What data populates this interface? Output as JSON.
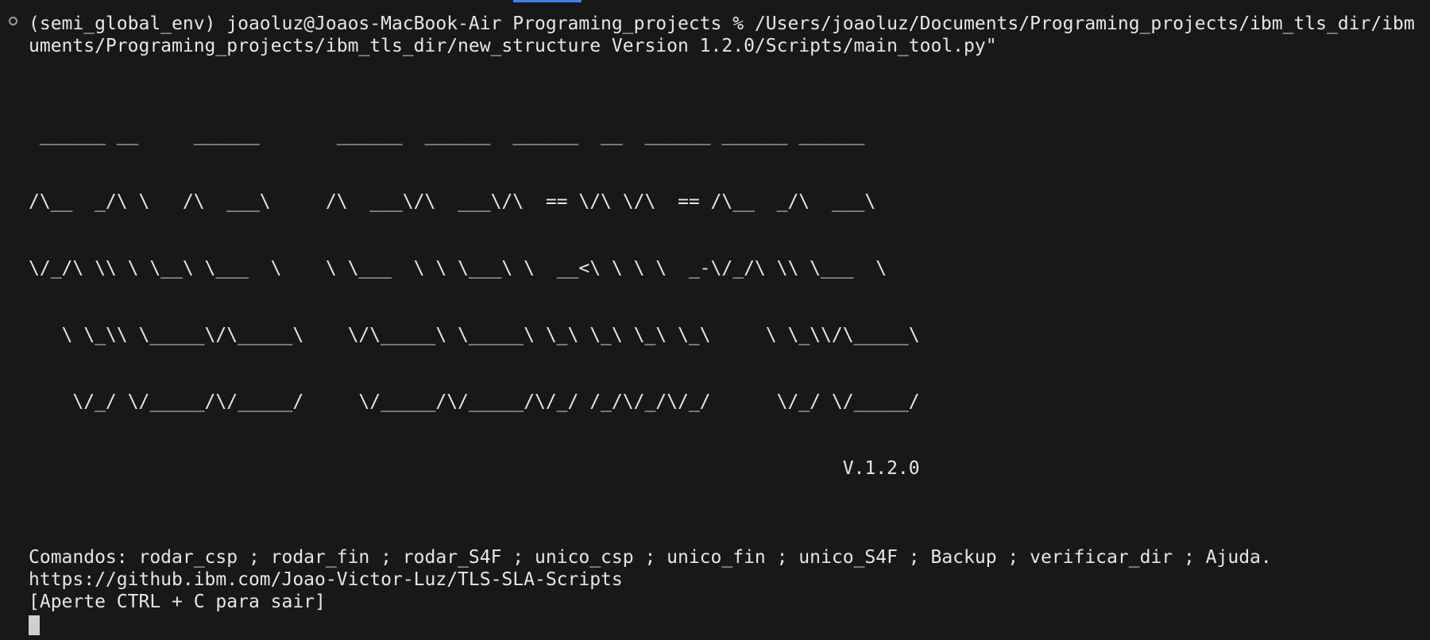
{
  "terminal": {
    "prompt_line": "(semi_global_env) joaoluz@Joaos-MacBook-Air Programing_projects % /Users/joaoluz/Documents/Programing_projects/ibm_tls_dir/ibm",
    "prompt_line_wrap": "uments/Programing_projects/ibm_tls_dir/new_structure Version 1.2.0/Scripts/main_tool.py\"",
    "ascii_banner": [
      " ______ __     ______       ______  ______  ______  __  ______ ______ ______",
      "/\\__  _/\\ \\   /\\  ___\\     /\\  ___\\/\\  ___\\/\\  == \\/\\ \\/\\  == /\\__  _/\\  ___\\",
      "\\/_/\\ \\\\ \\ \\__\\ \\___  \\    \\ \\___  \\ \\ \\___\\ \\  __<\\ \\ \\ \\  _-\\/_/\\ \\\\ \\___  \\",
      "   \\ \\_\\\\ \\_____\\/\\_____\\    \\/\\_____\\ \\_____\\ \\_\\ \\_\\ \\_\\ \\_\\     \\ \\_\\\\/\\_____\\",
      "    \\/_/ \\/_____/\\/_____/     \\/_____/\\/_____/\\/_/ /_/\\/_/\\/_/      \\/_/ \\/_____/",
      "                                                                          V.1.2.0"
    ],
    "commands_line": "Comandos: rodar_csp ; rodar_fin ; rodar_S4F ; unico_csp ; unico_fin ; unico_S4F ; Backup ; verificar_dir ; Ajuda.",
    "repo_url": "https://github.ibm.com/Joao-Victor-Luz/TLS-SLA-Scripts",
    "exit_hint": "[Aperte CTRL + C para sair]"
  },
  "colors": {
    "background": "#181818",
    "text": "#e6e6e6",
    "tab_indicator": "#3b82f6"
  }
}
